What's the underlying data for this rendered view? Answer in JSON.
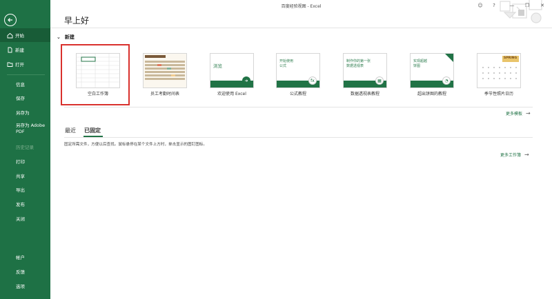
{
  "window": {
    "title": "百度经验视图 - Excel",
    "controls": [
      "☺",
      "?",
      "—",
      "❐",
      "✕"
    ]
  },
  "sidebar": {
    "items": [
      {
        "label": "开始",
        "icon": "home-icon"
      },
      {
        "label": "新建",
        "icon": "new-file-icon"
      },
      {
        "label": "打开",
        "icon": "folder-icon"
      },
      {
        "label": "信息"
      },
      {
        "label": "保存"
      },
      {
        "label": "另存为"
      },
      {
        "label": "另存为 Adobe PDF"
      },
      {
        "label": "历史记录"
      },
      {
        "label": "打印"
      },
      {
        "label": "共享"
      },
      {
        "label": "导出"
      },
      {
        "label": "发布"
      },
      {
        "label": "关闭"
      },
      {
        "label": "帐户"
      },
      {
        "label": "反馈"
      },
      {
        "label": "选项"
      }
    ]
  },
  "main": {
    "greeting": "早上好",
    "new_section": "新建",
    "templates": [
      {
        "label": "空白工作簿"
      },
      {
        "label": "员工考勤时间表",
        "thumb_title": "员工考勤时间表"
      },
      {
        "label": "欢迎使用 Excel",
        "thumb_text": "浏览"
      },
      {
        "label": "公式教程",
        "thumb_text": "开始使用\n公式"
      },
      {
        "label": "数据透视表教程",
        "thumb_text": "制作你的第一张\n数据透视表"
      },
      {
        "label": "超出饼图的教程",
        "thumb_text": "实现超越\n饼图"
      },
      {
        "label": "季节性照片日历",
        "thumb_title": "SPRING"
      }
    ],
    "more_templates": "更多模板",
    "tabs": [
      {
        "label": "最近"
      },
      {
        "label": "已固定"
      }
    ],
    "pinned_hint": "固定所需文件，方便以后查找。鼠标悬停在某个文件上方时，单击显示的图钉图标。",
    "more_workbooks": "更多工作簿"
  },
  "colors": {
    "accent": "#217346",
    "sidebar_bg": "#1e7145",
    "highlight": "#d9302c"
  }
}
